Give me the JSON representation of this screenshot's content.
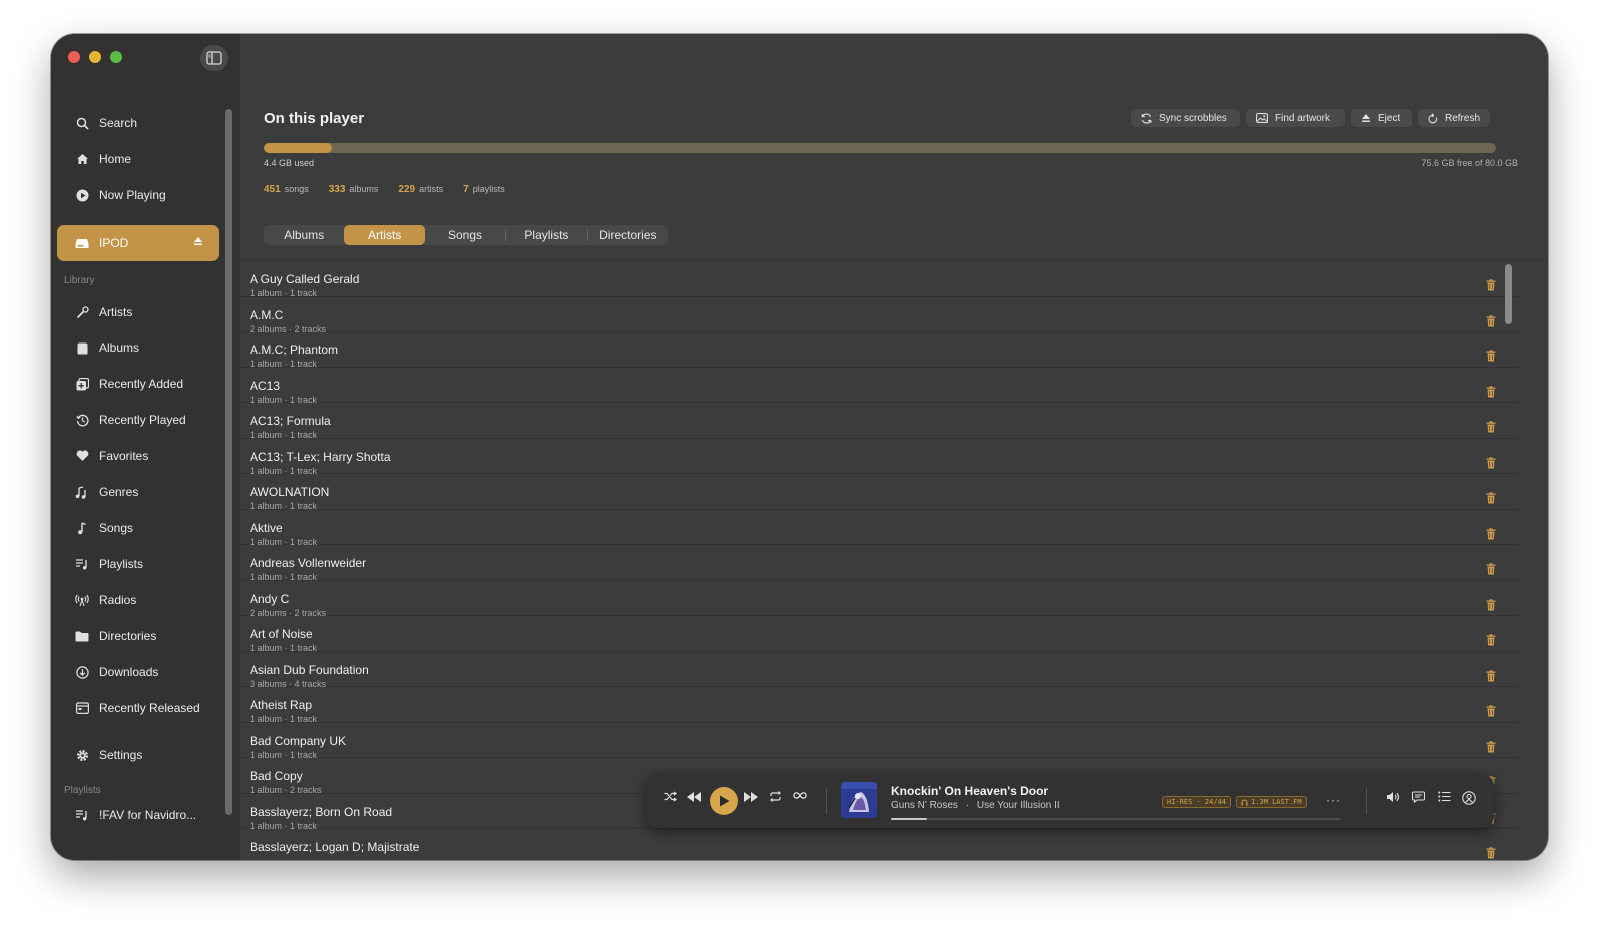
{
  "sidebar": {
    "nav_top": [
      {
        "label": "Search",
        "icon": "search-icon"
      },
      {
        "label": "Home",
        "icon": "home-icon"
      },
      {
        "label": "Now Playing",
        "icon": "play-circle-icon"
      }
    ],
    "device": {
      "label": "IPOD",
      "icon": "drive-icon"
    },
    "library_label": "Library",
    "library": [
      {
        "label": "Artists",
        "icon": "mic-icon"
      },
      {
        "label": "Albums",
        "icon": "album-icon"
      },
      {
        "label": "Recently Added",
        "icon": "add-box-icon"
      },
      {
        "label": "Recently Played",
        "icon": "history-icon"
      },
      {
        "label": "Favorites",
        "icon": "heart-icon"
      },
      {
        "label": "Genres",
        "icon": "genres-icon"
      },
      {
        "label": "Songs",
        "icon": "note-icon"
      },
      {
        "label": "Playlists",
        "icon": "playlist-icon"
      },
      {
        "label": "Radios",
        "icon": "radio-icon"
      },
      {
        "label": "Directories",
        "icon": "folder-icon"
      },
      {
        "label": "Downloads",
        "icon": "download-icon"
      },
      {
        "label": "Recently Released",
        "icon": "calendar-icon"
      }
    ],
    "settings": {
      "label": "Settings",
      "icon": "gear-icon"
    },
    "playlists_label": "Playlists",
    "playlists": [
      {
        "label": "!FAV for Navidro...",
        "icon": "playlist-icon"
      }
    ]
  },
  "header": {
    "title": "On this player",
    "buttons": [
      {
        "label": "Sync scrobbles",
        "icon": "sync-icon"
      },
      {
        "label": "Find artwork",
        "icon": "image-icon"
      },
      {
        "label": "Eject",
        "icon": "eject-icon"
      },
      {
        "label": "Refresh",
        "icon": "refresh-icon"
      }
    ]
  },
  "storage": {
    "used": "4.4 GB used",
    "free": "75.6 GB free of 80.0 GB",
    "used_fraction": 0.055
  },
  "stats": [
    {
      "value": "451",
      "label": "songs"
    },
    {
      "value": "333",
      "label": "albums"
    },
    {
      "value": "229",
      "label": "artists"
    },
    {
      "value": "7",
      "label": "playlists"
    }
  ],
  "tabs": [
    {
      "label": "Albums",
      "active": false
    },
    {
      "label": "Artists",
      "active": true
    },
    {
      "label": "Songs",
      "active": false
    },
    {
      "label": "Playlists",
      "active": false
    },
    {
      "label": "Directories",
      "active": false
    }
  ],
  "artists": [
    {
      "name": "A Guy Called Gerald",
      "sub": "1 album · 1 track"
    },
    {
      "name": "A.M.C",
      "sub": "2 albums · 2 tracks"
    },
    {
      "name": "A.M.C; Phantom",
      "sub": "1 album · 1 track"
    },
    {
      "name": "AC13",
      "sub": "1 album · 1 track"
    },
    {
      "name": "AC13; Formula",
      "sub": "1 album · 1 track"
    },
    {
      "name": "AC13; T-Lex; Harry Shotta",
      "sub": "1 album · 1 track"
    },
    {
      "name": "AWOLNATION",
      "sub": "1 album · 1 track"
    },
    {
      "name": "Aktive",
      "sub": "1 album · 1 track"
    },
    {
      "name": "Andreas Vollenweider",
      "sub": "1 album · 1 track"
    },
    {
      "name": "Andy C",
      "sub": "2 albums · 2 tracks"
    },
    {
      "name": "Art of Noise",
      "sub": "1 album · 1 track"
    },
    {
      "name": "Asian Dub Foundation",
      "sub": "3 albums · 4 tracks"
    },
    {
      "name": "Atheist Rap",
      "sub": "1 album · 1 track"
    },
    {
      "name": "Bad Company UK",
      "sub": "1 album · 1 track"
    },
    {
      "name": "Bad Copy",
      "sub": "1 album · 2 tracks"
    },
    {
      "name": "Basslayerz; Born On Road",
      "sub": "1 album · 1 track"
    },
    {
      "name": "Basslayerz; Logan D; Majistrate",
      "sub": ""
    }
  ],
  "player": {
    "title": "Knockin' On Heaven's Door",
    "artist": "Guns N' Roses",
    "separator": "·",
    "album": "Use Your Illusion II",
    "badge_quality": "HI-RES · 24/44",
    "badge_lastfm": "1.3M LAST.FM",
    "more": "···",
    "progress_fraction": 0.08
  },
  "colors": {
    "accent": "#c39347",
    "accent_text": "#d6a54c",
    "delete": "#d19a4a",
    "sidebar_bg": "#333231",
    "main_bg": "#3c3c3c"
  }
}
